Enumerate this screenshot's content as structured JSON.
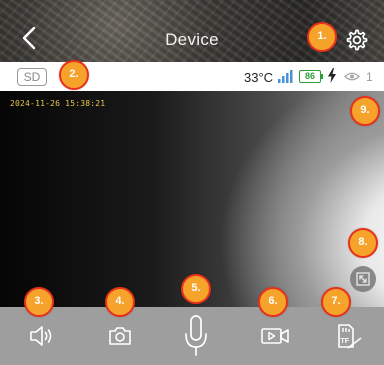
{
  "header": {
    "title": "Device",
    "back_icon": "chevron-left-icon",
    "settings_icon": "gear-icon"
  },
  "status": {
    "storage_badge": "SD",
    "temperature": "33°C",
    "battery_level": "86",
    "viewer_count": "1",
    "battery_color": "#2e9e3a"
  },
  "video": {
    "timestamp": "2024-11-26 15:38:21"
  },
  "toolbar": {
    "items": [
      {
        "name": "speaker",
        "icon": "speaker-icon"
      },
      {
        "name": "snapshot",
        "icon": "camera-icon"
      },
      {
        "name": "talk",
        "icon": "microphone-icon"
      },
      {
        "name": "record",
        "icon": "video-record-icon"
      },
      {
        "name": "tf-card",
        "icon": "tf-card-icon"
      }
    ]
  },
  "markers": [
    "1.",
    "2.",
    "3.",
    "4.",
    "5.",
    "6.",
    "7.",
    "8.",
    "9."
  ],
  "colors": {
    "marker_border": "#e8311b",
    "marker_fill": "#f5a32a",
    "toolbar_bg": "#9e9e9e",
    "timestamp": "#e6c84a"
  }
}
